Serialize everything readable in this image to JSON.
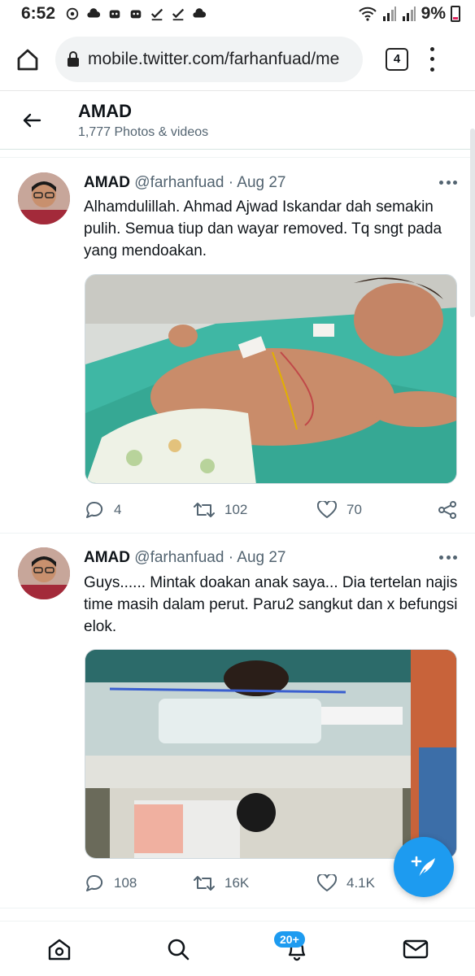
{
  "status_bar": {
    "time": "6:52",
    "battery": "9%"
  },
  "browser": {
    "url": "mobile.twitter.com/farhanfuad/me",
    "tab_count": "4"
  },
  "header": {
    "title": "AMAD",
    "subtitle": "1,777 Photos & videos"
  },
  "tweets": [
    {
      "name": "AMAD",
      "handle": "@farhanfuad",
      "dot": "·",
      "date": "Aug 27",
      "text": "Alhamdulillah. Ahmad Ajwad Iskandar dah semakin pulih. Semua tiup dan wayar removed. Tq sngt pada yang mendoakan.",
      "replies": "4",
      "retweets": "102",
      "likes": "70"
    },
    {
      "name": "AMAD",
      "handle": "@farhanfuad",
      "dot": "·",
      "date": "Aug 27",
      "text": "Guys...... Mintak doakan anak saya... Dia tertelan najis time masih dalam perut. Paru2 sangkut dan x befungsi elok.",
      "replies": "108",
      "retweets": "16K",
      "likes": "4.1K"
    }
  ],
  "bottom_nav": {
    "notifications_badge": "20+"
  },
  "colors": {
    "accent": "#1d9bf0",
    "muted_text": "#536471",
    "primary_text": "#0f1419"
  }
}
